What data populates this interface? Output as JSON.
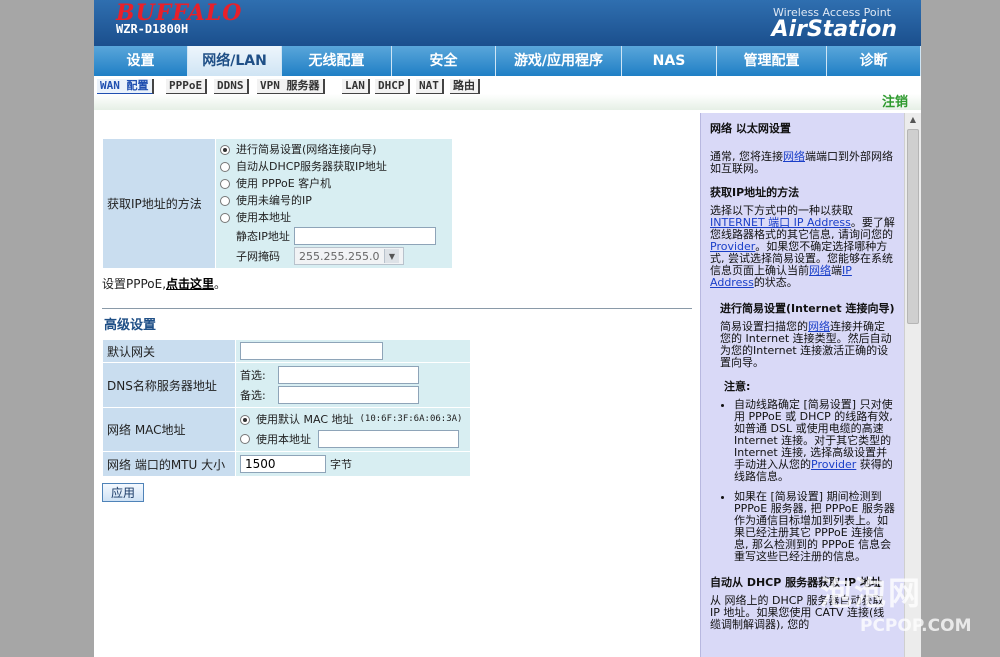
{
  "header": {
    "logo": "BUFFALO",
    "model": "WZR-D1800H",
    "tagline": "Wireless Access Point",
    "brand": "AirStation"
  },
  "nav": {
    "items": [
      "设置",
      "网络/LAN",
      "无线配置",
      "安全",
      "游戏/应用程序",
      "NAS",
      "管理配置",
      "诊断"
    ],
    "active": 1
  },
  "subnav": {
    "items": [
      "WAN 配置",
      "PPPoE",
      "DDNS",
      "VPN 服务器",
      "LAN",
      "DHCP",
      "NAT",
      "路由"
    ],
    "active": 0,
    "logout": "注销"
  },
  "ip_method": {
    "label": "获取IP地址的方法",
    "options": [
      "进行简易设置(网络连接向导)",
      "自动从DHCP服务器获取IP地址",
      "使用 PPPoE 客户机",
      "使用未编号的IP",
      "使用本地址"
    ],
    "selected": 0,
    "static_ip_label": "静态IP地址",
    "static_ip_value": "",
    "subnet_label": "子网掩码",
    "subnet_value": "255.255.255.0"
  },
  "pppoe_hint": {
    "text": "设置PPPoE,",
    "link": "点击这里",
    "suffix": "。"
  },
  "advanced": {
    "title": "高级设置",
    "gateway_label": "默认网关",
    "gateway_value": "",
    "dns_label": "DNS名称服务器地址",
    "dns_primary_label": "首选:",
    "dns_primary_value": "",
    "dns_secondary_label": "备选:",
    "dns_secondary_value": "",
    "mac_label": "网络 MAC地址",
    "mac_default_label": "使用默认 MAC 地址",
    "mac_default_value": "(10:6F:3F:6A:06:3A)",
    "mac_custom_label": "使用本地址",
    "mac_custom_value": "",
    "mtu_label": "网络 端口的MTU 大小",
    "mtu_value": "1500",
    "mtu_unit": "字节",
    "apply": "应用"
  },
  "help": {
    "title": "网络 以太网设置",
    "intro_pre": "通常, 您将连接",
    "intro_link": "网络",
    "intro_post": "端端口到外部网络如互联网。",
    "method_title": "获取IP地址的方法",
    "method_p1": "选择以下方式中的一种以获取",
    "method_link1": "INTERNET 端口 IP Address",
    "method_p2": "。要了解您线路器格式的其它信息, 请询问您的",
    "method_link2": "Provider",
    "method_p3": "。如果您不确定选择哪种方式, 尝试选择简易设置。您能够在系统信息页面上确认当前",
    "method_link3": "网络",
    "method_p4": "端",
    "method_link4": "IP Address",
    "method_p5": "的状态。",
    "easy_title": "进行简易设置(Internet 连接向导)",
    "easy_pre": "简易设置扫描您的",
    "easy_link": "网络",
    "easy_post": "连接并确定您的 Internet 连接类型。然后自动为您的Internet 连接激活正确的设置向导。",
    "note_title": "注意:",
    "note1_pre": "自动线路确定 [简易设置] 只对使用 PPPoE 或 DHCP 的线路有效, 如普通 DSL 或使用电缆的高速 Internet 连接。对于其它类型的 Internet 连接, 选择高级设置并手动进入从您的",
    "note1_link": "Provider",
    "note1_post": " 获得的线路信息。",
    "note2": "如果在 [简易设置] 期间检测到 PPPoE 服务器, 把 PPPoE 服务器作为通信目标增加到列表上。如果已经注册其它 PPPoE 连接信息, 那么检测到的 PPPoE 信息会重写这些已经注册的信息。",
    "auto_title": "自动从 DHCP 服务器获取 IP 地址",
    "auto_text": "从 网络上的 DHCP 服务器自动获取 IP 地址。如果您使用 CATV 连接(线缆调制解调器), 您的"
  },
  "watermark": {
    "text": "泡泡网",
    "sub": "PCPOP.COM"
  }
}
